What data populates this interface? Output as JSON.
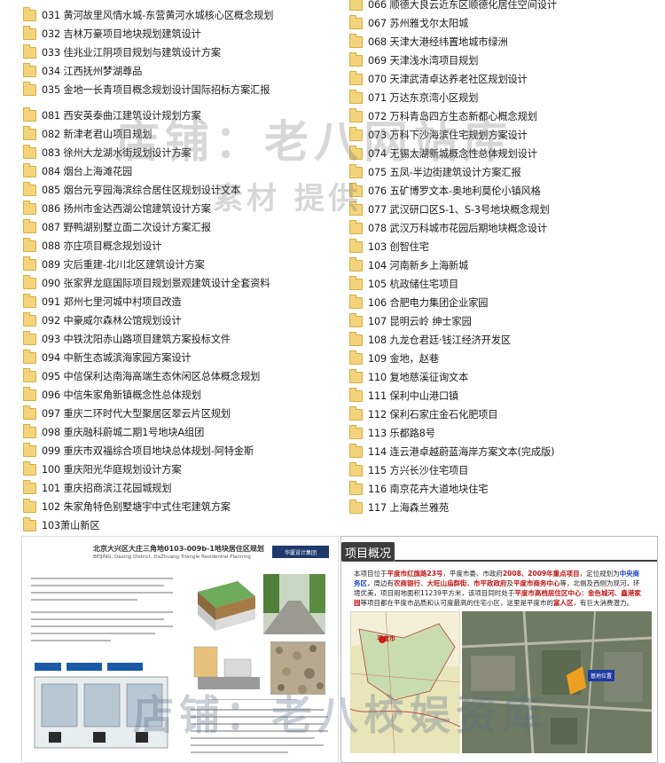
{
  "left_list": [
    "031 黄河故里风情水城-东营黄河水城核心区概念规划",
    "032 吉林万豪项目地块规划建筑设计",
    "033 佳兆业江阴项目规划与建筑设计方案",
    "034 江西抚州梦湖尊品",
    "035 金地一长青项目概念规划设计国际招标方案汇报",
    "081 西安英泰曲江建筑设计规划方案",
    "082 新津老君山项目规划",
    "083 徐州大龙湖水街规划设计方案",
    "084 烟台上海滩花园",
    "085 烟台元亨园海滨综合居住区规划设计文本",
    "086 扬州市金达西湖公馆建筑设计方案",
    "087 野鸭湖别墅立面二次设计方案汇报",
    "088 亦庄项目概念规划设计",
    "089 灾后重建-北川北区建筑设计方案",
    "090 张家界龙庭国际项目规划景观建筑设计全套资料",
    "091 郑州七里河城中村项目改造",
    "092 中豪威尔森林公馆规划设计",
    "093 中铁沈阳赤山路项目建筑方案投标文件",
    "094 中新生态城滨海家园方案设计",
    "095 中信保利达南海高端生态休闲区总体概念规划",
    "096 中信朱家角新镇概念性总体规划",
    "097 重庆二环时代大型聚居区翠云片区规划",
    "098 重庆融科蔚城二期1号地块A组团",
    "099 重庆市双福综合项目地块总体规划-阿特金斯",
    "100 重庆阳光华庭规划设计方案",
    "101 重庆招商滨江花园城规划",
    "102 朱家角特色别墅塘宇中式住宅建筑方案",
    "103萧山新区"
  ],
  "right_list": [
    "066 顺德大良云近东区顺德化居住空间设计",
    "067 苏州雅戈尔太阳城",
    "068 天津大港经纬置地城市绿洲",
    "069 天津浅水湾项目规划",
    "070 天津武清卓达养老社区规划设计",
    "071 万达东京湾小区规划",
    "072 万科青岛四方生态新都心概念规划",
    "073 万科下沙海滨住宅规划方案设计",
    "074 无锡太湖新城概念性总体规划设计",
    "075 五凤-半边街建筑设计方案汇报",
    "076 五矿博罗文本-奥地利莫伦小镇风格",
    "077 武汉研口区S-1、S-3号地块概念规划",
    "078 武汉万科城市花园后期地块概念设计",
    "103 创智住宅",
    "104 河南新乡上海新城",
    "105 杭政储住宅项目",
    "106 合肥电力集团企业家园",
    "107 昆明云岭 绅士家园",
    "108 九龙仓君廷·钱江经济开发区",
    "109 金地，赵巷",
    "110 复地慈溪征询文本",
    "111 保利中山港口镇",
    "112 保利石家庄金石化肥项目",
    "113 乐都路8号",
    "114 连云港卓越蔚蓝海岸方案文本(完成版)",
    "115 方兴长沙住宅项目",
    "116 南京花卉大道地块住宅",
    "117 上海森兰雅苑"
  ],
  "watermarks": {
    "top_large": "店铺：老八网站库",
    "top_small": "素材 提供",
    "bottom": "店铺：老八校娱资库"
  },
  "preview_left": {
    "title": "北京大兴区大庄三角地0103-009b-1地块居住区规划",
    "subtitle": "BEIJING, Daxing District, DaZhuang Triangle Residential Planning",
    "logo": "华厦设计集团"
  },
  "preview_right": {
    "header": "项目概况",
    "desc_parts": [
      {
        "t": "本项目位于",
        "c": "n"
      },
      {
        "t": "平度市红旗路23号",
        "c": "r"
      },
      {
        "t": "，平度市委、市政府",
        "c": "n"
      },
      {
        "t": "2008、2009年重点项目",
        "c": "r"
      },
      {
        "t": "，定位规划为",
        "c": "n"
      },
      {
        "t": "中央商务区",
        "c": "b"
      },
      {
        "t": "，周边有",
        "c": "n"
      },
      {
        "t": "农商银行",
        "c": "r"
      },
      {
        "t": "、",
        "c": "n"
      },
      {
        "t": "大旺山庙群街",
        "c": "r"
      },
      {
        "t": "、",
        "c": "n"
      },
      {
        "t": "市平政政府",
        "c": "r"
      },
      {
        "t": "及",
        "c": "n"
      },
      {
        "t": "平度市商务中心",
        "c": "r"
      },
      {
        "t": "等，北侧及西侧为现河，环境优美，项目用地面积11239平方米，该项目同时处于",
        "c": "n"
      },
      {
        "t": "平度市高档居住区中心：金色城河、鑫港家园",
        "c": "r"
      },
      {
        "t": "等项目都在平度市品质和认可度最高的住宅小区，这里是平度市的",
        "c": "n"
      },
      {
        "t": "富人区",
        "c": "r"
      },
      {
        "t": "，有巨大消费潜力。",
        "c": "n"
      }
    ],
    "map_label": "平度市",
    "sat_label": "基地位置"
  },
  "colors": {
    "folder": "#f3d47c",
    "header_dark": "#3d3d3d",
    "highlight_red": "#c01515",
    "highlight_blue": "#1a43c8"
  }
}
